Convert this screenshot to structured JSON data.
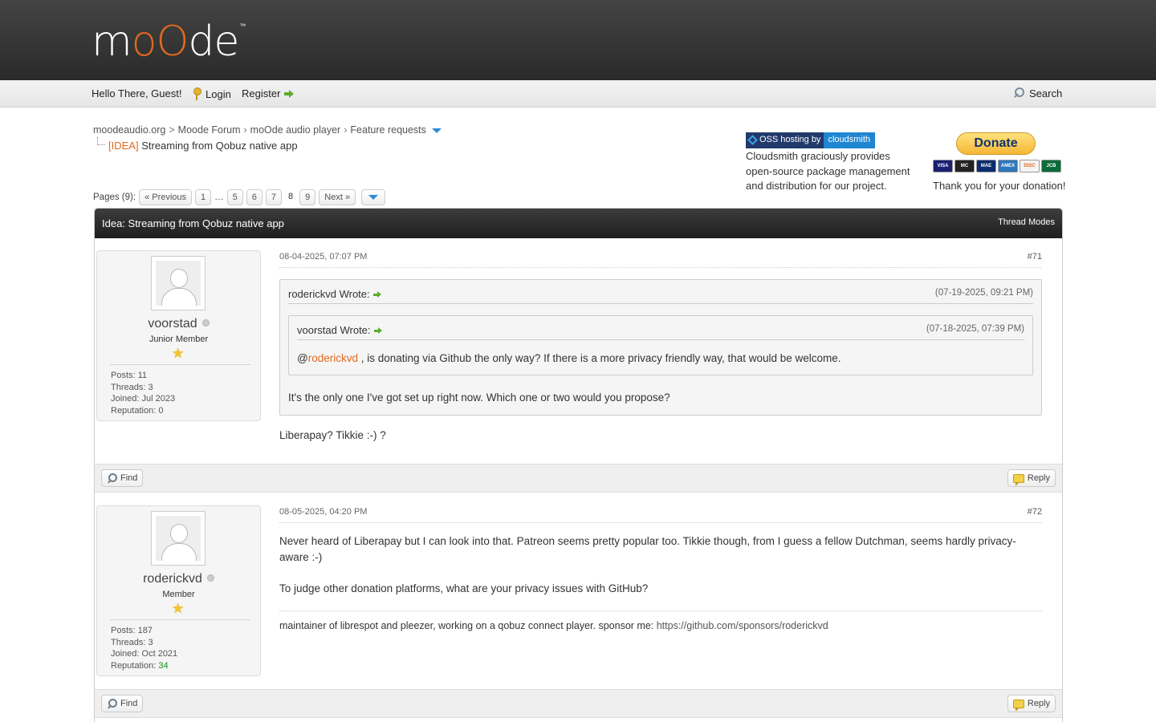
{
  "header": {
    "logo_text": "moOde",
    "logo_tm": "™"
  },
  "menu": {
    "greeting": "Hello There, Guest!",
    "login": "Login",
    "register": "Register",
    "search": "Search"
  },
  "breadcrumb": {
    "items": [
      "moodeaudio.org",
      "Moode Forum",
      "moOde audio player",
      "Feature requests"
    ],
    "separators": [
      ">",
      "›",
      "›"
    ],
    "thread_prefix": "[IDEA]",
    "thread_title": "Streaming from Qobuz native app"
  },
  "sponsor": {
    "oss_left": "OSS hosting by",
    "oss_right": "cloudsmith",
    "oss_text": "Cloudsmith graciously provides open-source package management and distribution for our project.",
    "donate_label": "Donate",
    "cards": [
      "VISA",
      "MC",
      "MAE",
      "AMEX",
      "DISC",
      "JCB"
    ],
    "thanks": "Thank you for your donation!"
  },
  "pagination": {
    "label": "Pages (9):",
    "previous": "« Previous",
    "pages": [
      "1",
      "…",
      "5",
      "6",
      "7",
      "8",
      "9"
    ],
    "current": "8",
    "next": "Next »"
  },
  "thread": {
    "title": "Idea: Streaming from Qobuz native app",
    "modes": "Thread Modes"
  },
  "posts": [
    {
      "author": "voorstad",
      "rank": "Junior Member",
      "stats": {
        "posts": "Posts: 11",
        "threads": "Threads: 3",
        "joined": "Joined: Jul 2023",
        "reputation_label": "Reputation:",
        "reputation": "0"
      },
      "date": "08-04-2025, 07:07 PM",
      "number": "#71",
      "quote": {
        "who": "roderickvd Wrote:",
        "when": "(07-19-2025, 09:21 PM)",
        "inner": {
          "who": "voorstad Wrote:",
          "when": "(07-18-2025, 07:39 PM)",
          "at": "@",
          "mention": "roderickvd",
          "text": " , is donating via Github the only way? If there is a more privacy friendly way, that would be welcome."
        },
        "text": "It's the only one I've got set up right now. Which one or two would you propose?"
      },
      "text": "Liberapay? Tikkie :-) ?",
      "find": "Find",
      "reply": "Reply"
    },
    {
      "author": "roderickvd",
      "rank": "Member",
      "stats": {
        "posts": "Posts: 187",
        "threads": "Threads: 3",
        "joined": "Joined: Oct 2021",
        "reputation_label": "Reputation:",
        "reputation": "34"
      },
      "date": "08-05-2025, 04:20 PM",
      "number": "#72",
      "text1": "Never heard of Liberapay but I can look into that. Patreon seems pretty popular too. Tikkie though, from I guess a fellow Dutchman, seems hardly privacy-aware :-)",
      "text2": "To judge other donation platforms, what are your privacy issues with GitHub?",
      "signature": "maintainer of librespot and pleezer, working on a qobuz connect player. sponsor me: ",
      "signature_url": "https://github.com/sponsors/roderickvd",
      "find": "Find",
      "reply": "Reply"
    }
  ],
  "colors": {
    "accent": "#e0691f",
    "header_bg": "#2a2a2a",
    "link_blue": "#2e8bd6",
    "reputation_positive": "#188f16"
  }
}
